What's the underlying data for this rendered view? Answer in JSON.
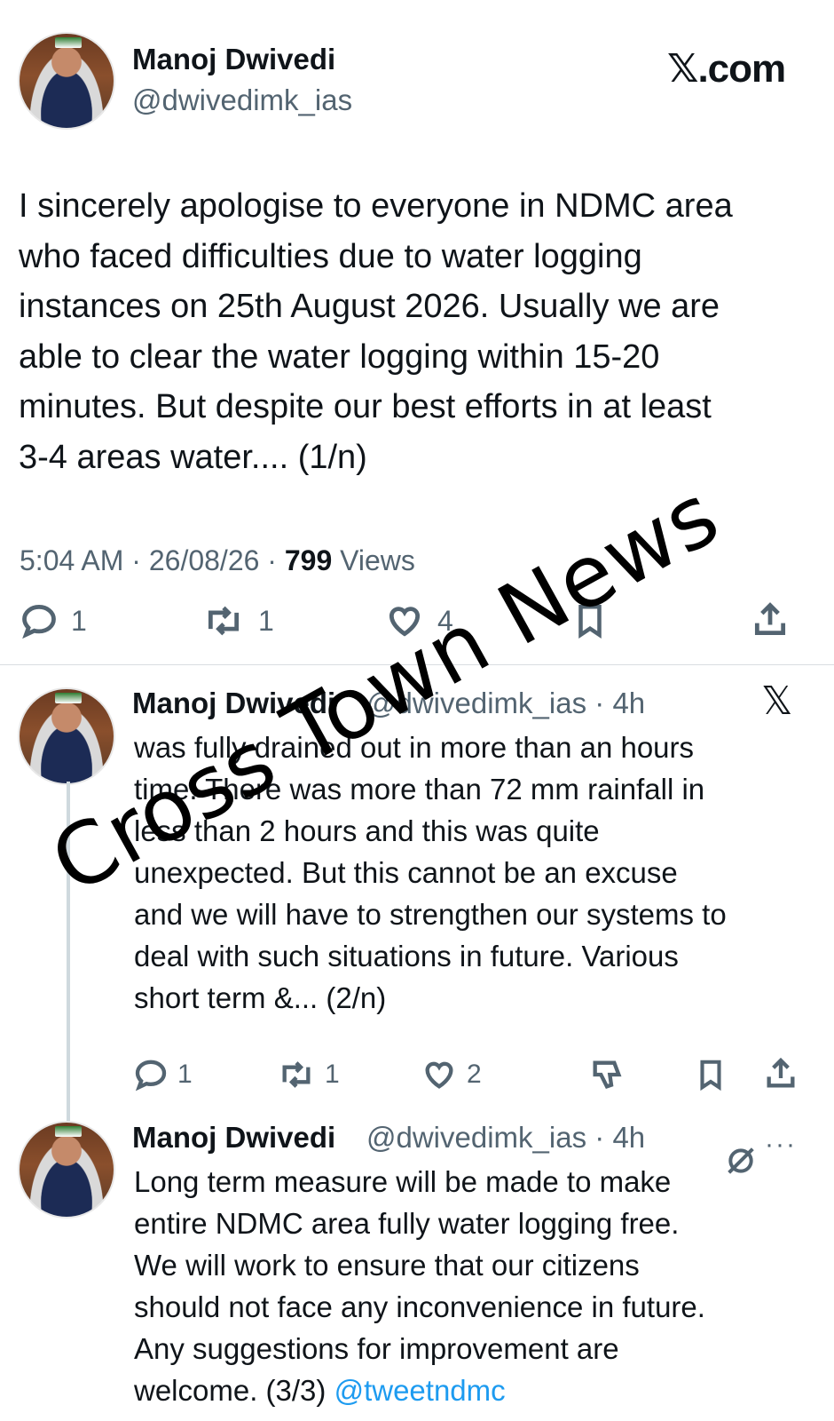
{
  "site_label": "𝕏.com",
  "main_tweet": {
    "author_name": "Manoj Dwivedi",
    "author_handle": "@dwivedimk_ias",
    "text_lines": [
      "I sincerely apologise to everyone in NDMC area",
      "who faced difficulties due to water logging",
      "instances on 25th August 2026. Usually we are",
      "able to clear the water logging within 15-20",
      "minutes. But despite our best efforts in at least",
      "3-4 areas water.... (1/n)"
    ],
    "time": "5:04 AM",
    "date": "26/08/26",
    "views_count": "799",
    "views_label": "Views",
    "replies": "1",
    "reposts": "1",
    "likes": "4"
  },
  "reply_1": {
    "author_name": "Manoj Dwivedi",
    "author_handle": "@dwivedimk_ias",
    "age": "4h",
    "text_lines": [
      "was fully drained out in more than an hours",
      "time. There was more than 72 mm rainfall in",
      "less than 2 hours and this was quite",
      "unexpected. But this cannot be an excuse",
      "and we will have to strengthen our systems to",
      "deal with such situations in future. Various",
      "short term &... (2/n)"
    ],
    "replies": "1",
    "reposts": "1",
    "likes": "2"
  },
  "reply_2": {
    "author_name": "Manoj Dwivedi",
    "author_handle": "@dwivedimk_ias",
    "age": "4h",
    "text_lines": [
      "Long term measure will be made to make",
      "entire NDMC area fully water logging free.",
      "We will work to ensure that our citizens",
      "should not face any inconvenience in future.",
      "Any suggestions for improvement are"
    ],
    "last_line_prefix": "welcome. (3/3) ",
    "last_line_link": "@tweetndmc",
    "more_label": "···"
  },
  "watermark": "Cross Town News",
  "separator": "·",
  "colors": {
    "text": "#0f1419",
    "secondary": "#536471",
    "link": "#1d9bf0",
    "divider": "#d9dde1"
  },
  "icons": [
    "reply-icon",
    "repost-icon",
    "like-icon",
    "bookmark-icon",
    "share-icon",
    "x-logo-icon",
    "grok-icon",
    "more-icon",
    "dislike-icon"
  ]
}
